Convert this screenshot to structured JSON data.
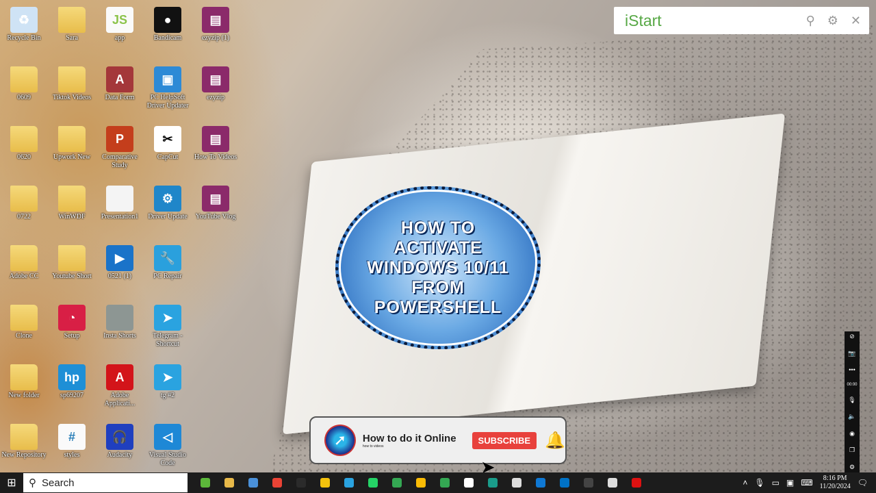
{
  "desktop": {
    "rows": [
      [
        {
          "label": "Recycle Bin",
          "icon": "recycle-bin",
          "color": "#cfe3f5",
          "glyph": "♻"
        },
        {
          "label": "Sara",
          "icon": "folder",
          "glyph": ""
        },
        {
          "label": "app",
          "icon": "js-file",
          "color": "#fafafa",
          "glyph": "JS"
        },
        {
          "label": "Bandicam",
          "icon": "bandicam",
          "color": "#111",
          "glyph": "●"
        },
        {
          "label": "ezyzip (1)",
          "icon": "winrar",
          "color": "#8b2a6a",
          "glyph": "▤"
        }
      ],
      [
        {
          "label": "0609",
          "icon": "folder",
          "glyph": ""
        },
        {
          "label": "Tiktok Videos",
          "icon": "folder",
          "glyph": ""
        },
        {
          "label": "Data Form",
          "icon": "access",
          "color": "#a4373a",
          "glyph": "A"
        },
        {
          "label": "PC HelpSoft Driver Updater",
          "icon": "driver-updater",
          "color": "#2d8ad6",
          "glyph": "▣"
        },
        {
          "label": "ezyzip",
          "icon": "winrar",
          "color": "#8b2a6a",
          "glyph": "▤"
        }
      ],
      [
        {
          "label": "0620",
          "icon": "folder",
          "glyph": ""
        },
        {
          "label": "Upwork New",
          "icon": "folder",
          "glyph": ""
        },
        {
          "label": "Comparative Study",
          "icon": "powerpoint",
          "color": "#c43e1c",
          "glyph": "P"
        },
        {
          "label": "CapCut",
          "icon": "capcut",
          "color": "#fff",
          "glyph": "✂"
        },
        {
          "label": "How To Videos",
          "icon": "winrar",
          "color": "#8b2a6a",
          "glyph": "▤"
        }
      ],
      [
        {
          "label": "0722",
          "icon": "folder",
          "glyph": ""
        },
        {
          "label": "WinWDF",
          "icon": "folder",
          "glyph": ""
        },
        {
          "label": "Presentation1",
          "icon": "presentation",
          "color": "#f4f4f4",
          "glyph": ""
        },
        {
          "label": "Driver Update",
          "icon": "driver-update",
          "color": "#1f86c9",
          "glyph": "⚙"
        },
        {
          "label": "YouTube Vlog",
          "icon": "winrar",
          "color": "#8b2a6a",
          "glyph": "▤"
        }
      ],
      [
        {
          "label": "Adobe CC",
          "icon": "folder",
          "glyph": ""
        },
        {
          "label": "Youtube Short",
          "icon": "folder",
          "glyph": ""
        },
        {
          "label": "0521 (1)",
          "icon": "video-file",
          "color": "#1a73c9",
          "glyph": "▶"
        },
        {
          "label": "PC Repair",
          "icon": "pc-repair",
          "color": "#2aa0dd",
          "glyph": "🔧"
        }
      ],
      [
        {
          "label": "Clone",
          "icon": "folder",
          "glyph": ""
        },
        {
          "label": "Setup",
          "icon": "setup",
          "color": "#d81f45",
          "glyph": "◔"
        },
        {
          "label": "Insta Shorts",
          "icon": "file",
          "color": "#8d9693",
          "glyph": ""
        },
        {
          "label": "Telegram - Shortcut",
          "icon": "telegram",
          "color": "#2aa3e0",
          "glyph": "➤"
        }
      ],
      [
        {
          "label": "New folder",
          "icon": "folder",
          "glyph": ""
        },
        {
          "label": "sp69207",
          "icon": "hp",
          "color": "#1e8fd6",
          "glyph": "hp"
        },
        {
          "label": "Adobe Applicati...",
          "icon": "adobe",
          "color": "#d3141a",
          "glyph": "A"
        },
        {
          "label": "tg #2",
          "icon": "telegram",
          "color": "#2aa3e0",
          "glyph": "➤"
        }
      ],
      [
        {
          "label": "New Repository",
          "icon": "folder",
          "glyph": ""
        },
        {
          "label": "styles",
          "icon": "css-file",
          "color": "#fafafa",
          "glyph": "#"
        },
        {
          "label": "Audacity",
          "icon": "audacity",
          "color": "#1f3fbf",
          "glyph": "🎧"
        },
        {
          "label": "Visual Studio Code",
          "icon": "vscode",
          "color": "#1e88d6",
          "glyph": "◁"
        }
      ]
    ]
  },
  "istart": {
    "brand": "iStart",
    "search_icon": "⚲",
    "settings_icon": "⚙",
    "close_icon": "✕"
  },
  "thumbnail": {
    "title_lines": [
      "HOW TO",
      "ACTIVATE",
      "WINDOWS 10/11",
      "FROM",
      "POWERSHELL"
    ]
  },
  "channel": {
    "name": "How to do it Online",
    "tagline": "how to videos",
    "subscribe": "SUBSCRIBE"
  },
  "recorder": {
    "timer": "00:00"
  },
  "taskbar": {
    "search_placeholder": "Search",
    "apps": [
      "#5cb83a",
      "#e8b949",
      "#4a90d9",
      "#ea4335",
      "#2b2b2b",
      "#f4c20d",
      "#2aa3e0",
      "#25d366",
      "#34a853",
      "#fbbc05",
      "#34a853",
      "#ffffff",
      "#1a9c8a",
      "#ddd",
      "#0f78d4",
      "#0072c6",
      "#444",
      "#ddd",
      "#d11"
    ],
    "time": "8:16 PM",
    "date": "11/20/2024"
  }
}
